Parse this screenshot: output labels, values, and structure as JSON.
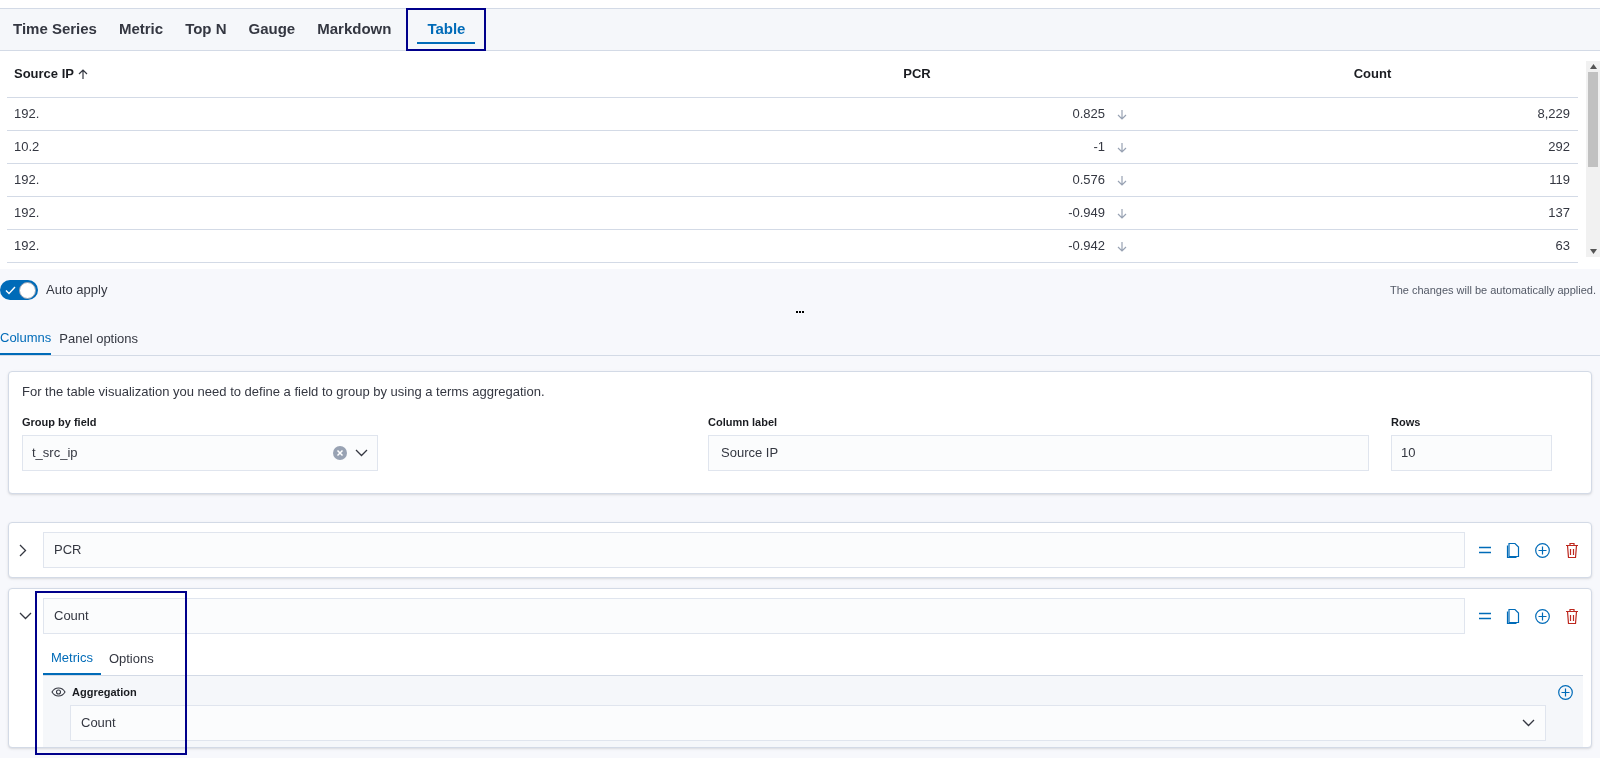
{
  "tabs": [
    {
      "label": "Time Series",
      "selected": false,
      "highlighted": false
    },
    {
      "label": "Metric",
      "selected": false,
      "highlighted": false
    },
    {
      "label": "Top N",
      "selected": false,
      "highlighted": false
    },
    {
      "label": "Gauge",
      "selected": false,
      "highlighted": false
    },
    {
      "label": "Markdown",
      "selected": false,
      "highlighted": false
    },
    {
      "label": "Table",
      "selected": true,
      "highlighted": true
    }
  ],
  "table": {
    "columns": [
      {
        "label": "Source IP",
        "sorted_ascending": true
      },
      {
        "label": "PCR",
        "sorted_ascending": false
      },
      {
        "label": "Count",
        "sorted_ascending": false
      }
    ],
    "rows": [
      [
        "192.",
        "0.825",
        "8,229"
      ],
      [
        "10.2",
        "-1",
        "292"
      ],
      [
        "192.",
        "0.576",
        "119"
      ],
      [
        "192.",
        "-0.949",
        "137"
      ],
      [
        "192.",
        "-0.942",
        "63"
      ]
    ]
  },
  "auto_apply": {
    "label": "Auto apply",
    "on": true,
    "note": "The changes will be automatically applied."
  },
  "editor_tabs": [
    {
      "label": "Columns",
      "selected": true
    },
    {
      "label": "Panel options",
      "selected": false
    }
  ],
  "group_card": {
    "intro": "For the table visualization you need to define a field to group by using a terms aggregation.",
    "group_by_label": "Group by field",
    "group_by_value": "t_src_ip",
    "column_label_label": "Column label",
    "column_label_value": "Source IP",
    "rows_label": "Rows",
    "rows_value": "10"
  },
  "series": [
    {
      "label": "PCR",
      "expanded": false,
      "highlighted": false
    },
    {
      "label": "Count",
      "expanded": true,
      "highlighted": true,
      "tabs": [
        {
          "label": "Metrics",
          "selected": true
        },
        {
          "label": "Options",
          "selected": false
        }
      ],
      "aggregation_label": "Aggregation",
      "aggregation_value": "Count"
    }
  ]
}
